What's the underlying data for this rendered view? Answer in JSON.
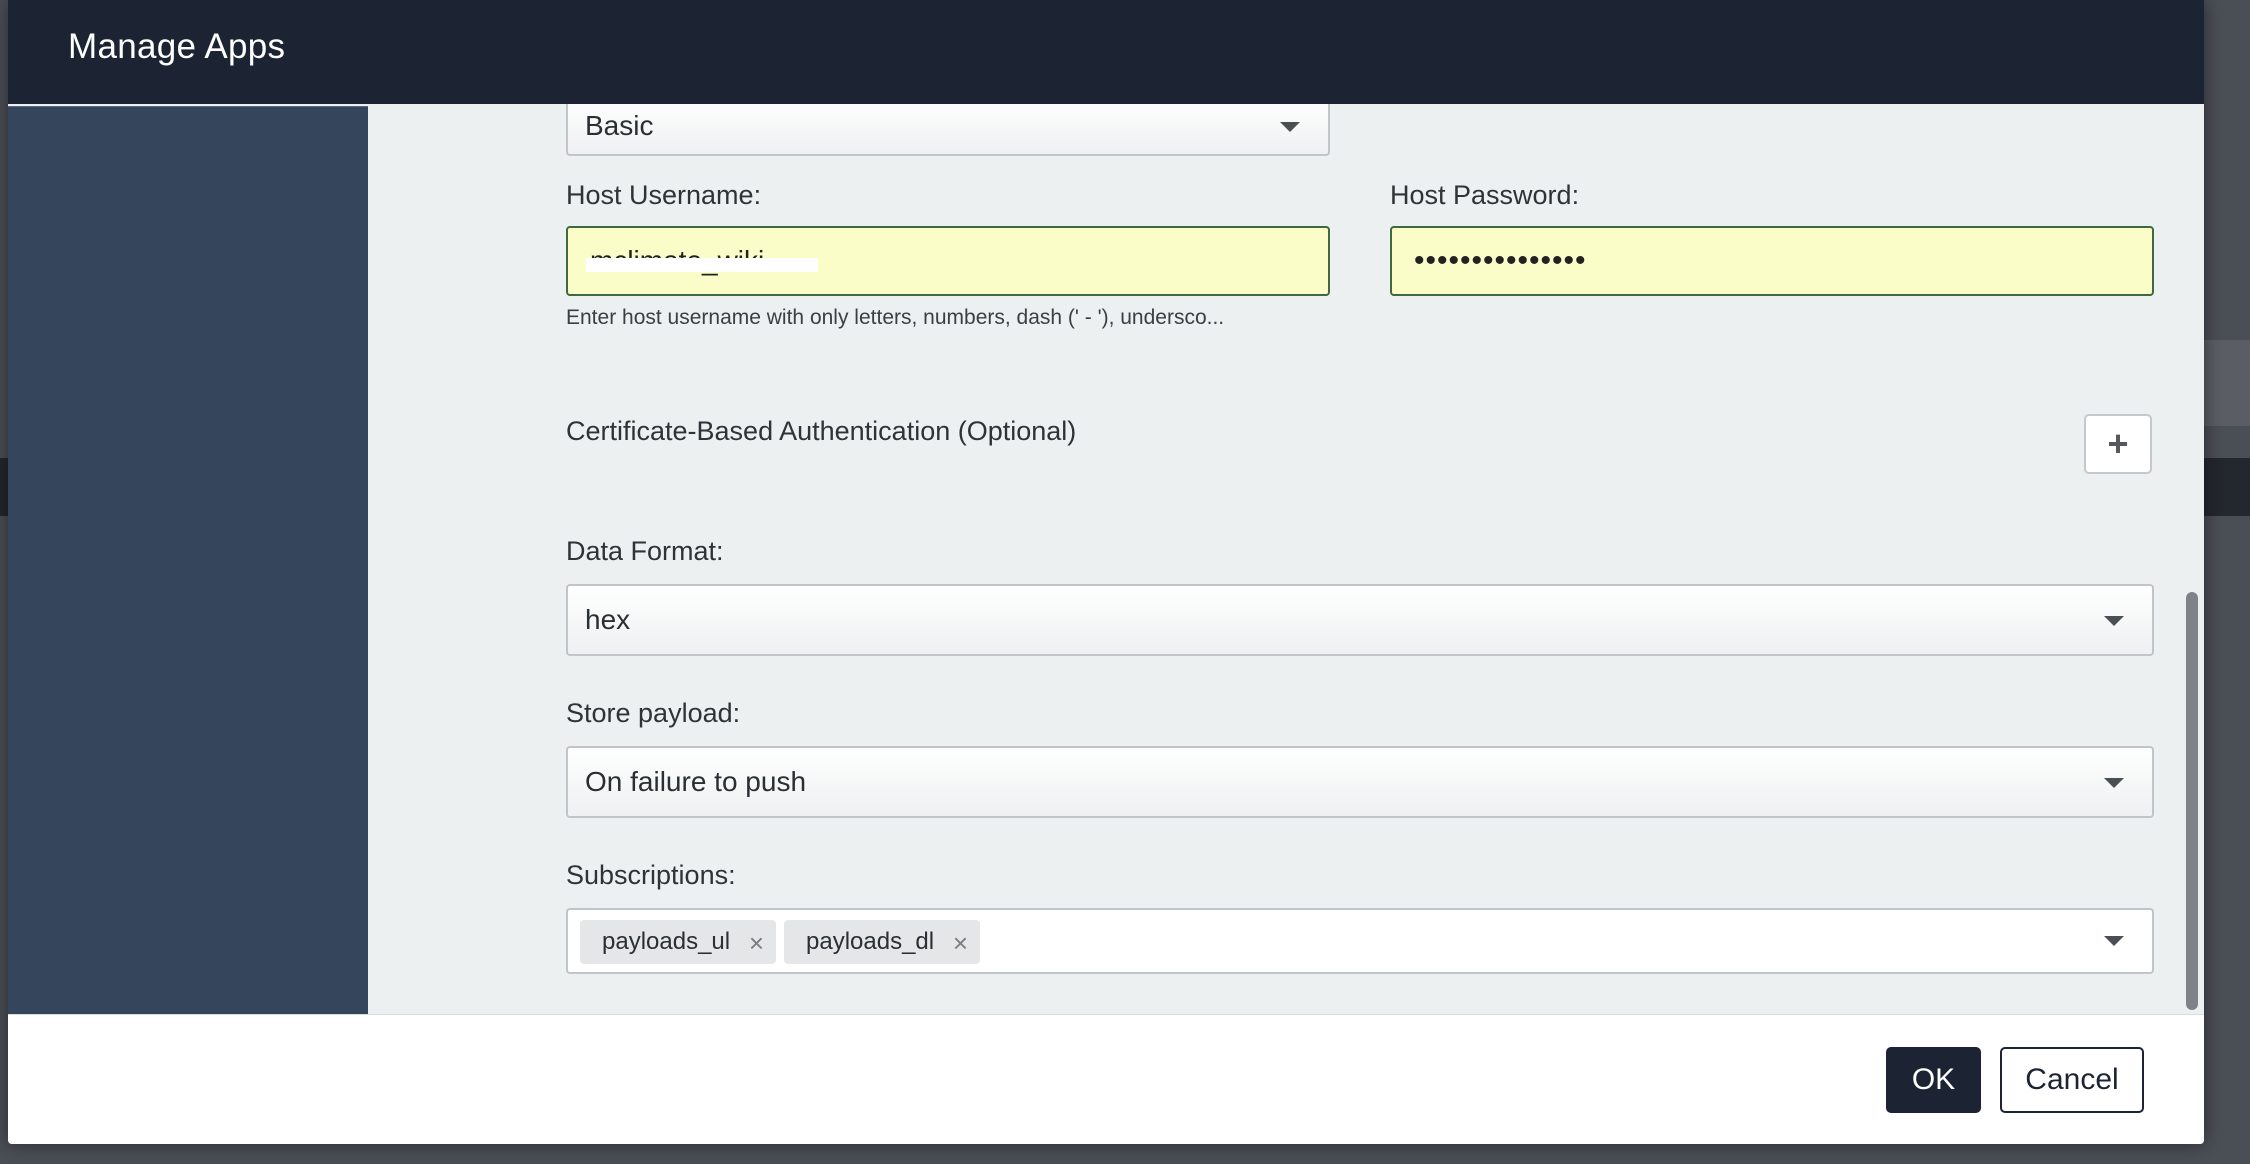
{
  "modal": {
    "title": "Manage Apps"
  },
  "auth_type": {
    "selected": "Basic"
  },
  "host_username": {
    "label": "Host Username:",
    "value": "mclimate_wiki",
    "hint": "Enter host username with only letters, numbers, dash (' - '), undersco..."
  },
  "host_password": {
    "label": "Host Password:",
    "value": "•••••••••••••••"
  },
  "certificate_auth": {
    "label": "Certificate-Based Authentication (Optional)",
    "add_icon": "plus-icon",
    "add_glyph": "+"
  },
  "data_format": {
    "label": "Data Format:",
    "selected": "hex"
  },
  "store_payload": {
    "label": "Store payload:",
    "selected": "On failure to push"
  },
  "subscriptions": {
    "label": "Subscriptions:",
    "tags": [
      {
        "label": "payloads_ul",
        "remove_glyph": "×"
      },
      {
        "label": "payloads_dl",
        "remove_glyph": "×"
      }
    ]
  },
  "footer": {
    "ok_label": "OK",
    "cancel_label": "Cancel"
  },
  "colors": {
    "header_bg": "#1c2434",
    "sidebar_bg": "#34455c",
    "body_bg": "#ecf0f1",
    "autofill_bg": "#fafdc8",
    "autofill_border": "#3f6a3f"
  }
}
